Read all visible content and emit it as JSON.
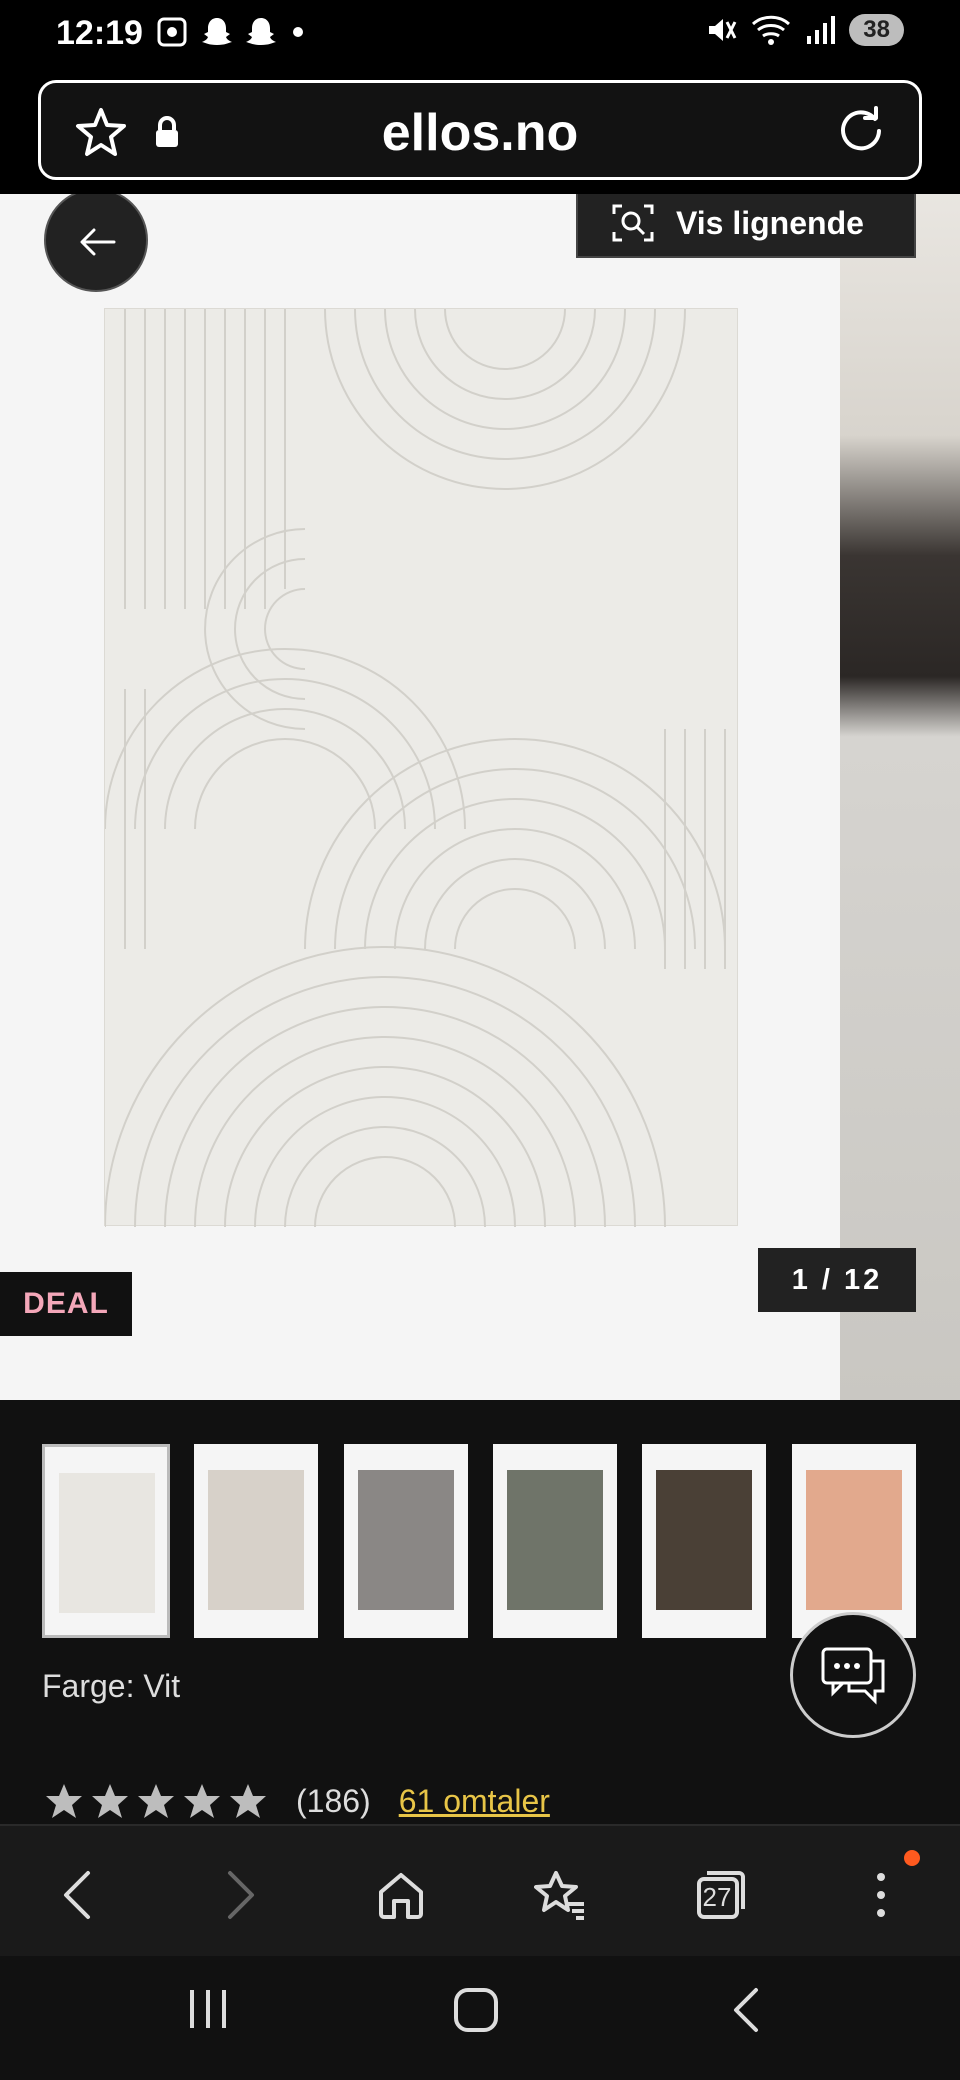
{
  "status_bar": {
    "time": "12:19",
    "battery": "38"
  },
  "address_bar": {
    "url": "ellos.no"
  },
  "product": {
    "similar_label": "Vis lignende",
    "deal_badge": "DEAL",
    "image_counter": "1 / 12",
    "color_label": "Farge: Vit",
    "thumbnails": [
      {
        "color": "#e8e6e1"
      },
      {
        "color": "#d7d1c9"
      },
      {
        "color": "#8a8785"
      },
      {
        "color": "#6f7469"
      },
      {
        "color": "#4a4036"
      },
      {
        "color": "#e2a98d"
      }
    ],
    "rating": {
      "stars": 5,
      "count": "(186)",
      "reviews_link": "61 omtaler"
    }
  },
  "colors": {
    "accent_link": "#e8c547",
    "deal_text": "#f4a7b9",
    "notification_dot": "#ff5a1f"
  },
  "toolbar": {
    "tab_count": "27",
    "icons": [
      "back-icon",
      "forward-icon",
      "home-icon",
      "bookmarks-icon",
      "tabs-icon",
      "menu-icon"
    ]
  }
}
